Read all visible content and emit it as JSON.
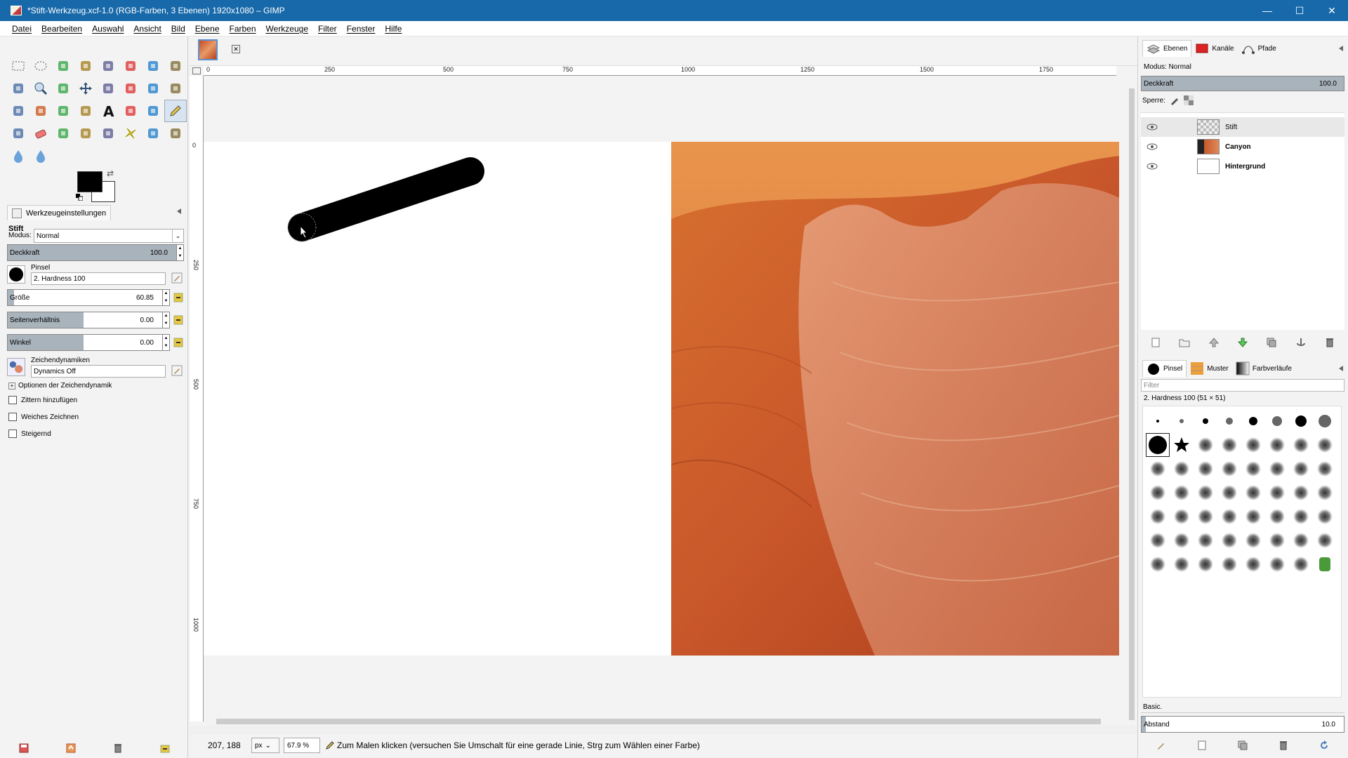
{
  "window": {
    "title": "*Stift-Werkzeug.xcf-1.0 (RGB-Farben, 3 Ebenen) 1920x1080 – GIMP",
    "minimize": "—",
    "maximize": "☐",
    "close": "✕"
  },
  "menu": [
    "Datei",
    "Bearbeiten",
    "Auswahl",
    "Ansicht",
    "Bild",
    "Ebene",
    "Farben",
    "Werkzeuge",
    "Filter",
    "Fenster",
    "Hilfe"
  ],
  "toolbox": {
    "tools": [
      "rect-select-icon",
      "ellipse-select-icon",
      "lasso-icon",
      "fuzzy-select-icon",
      "color-select-icon",
      "scissors-icon",
      "foreground-select-icon",
      "paths-icon",
      "color-picker-icon",
      "zoom-icon",
      "measure-icon",
      "move-icon",
      "align-icon",
      "crop-icon",
      "rotate-icon",
      "scale-icon",
      "shear-icon",
      "perspective-icon",
      "flip-icon",
      "cage-icon",
      "text-icon",
      "heal-icon",
      "blend-icon",
      "pencil-icon",
      "paintbrush-icon",
      "eraser-icon",
      "airbrush-icon",
      "ink-icon",
      "clone-icon",
      "heal2-icon",
      "smudge-icon",
      "dodge-icon",
      "blur-icon",
      "bucket-icon"
    ],
    "active_tool": "pencil-icon",
    "fg_color": "#000000",
    "bg_color": "#ffffff"
  },
  "tool_options": {
    "tab_label": "Werkzeugeinstellungen",
    "tool_name": "Stift",
    "mode_label": "Modus:",
    "mode_value": "Normal",
    "opacity_label": "Deckkraft",
    "opacity_value": "100.0",
    "opacity_level": 1.0,
    "brush_label": "Pinsel",
    "brush_value": "2. Hardness 100",
    "size_label": "Größe",
    "size_value": "60.85",
    "size_level": 0.04,
    "aspect_label": "Seitenverhältnis",
    "aspect_value": "0.00",
    "angle_label": "Winkel",
    "angle_value": "0.00",
    "dynamics_label": "Zeichendynamiken",
    "dynamics_value": "Dynamics Off",
    "dynamics_options": "Optionen der Zeichendynamik",
    "jitter": "Zittern hinzufügen",
    "smooth": "Weiches Zeichnen",
    "incremental": "Steigernd"
  },
  "ruler": {
    "top": [
      "0",
      "250",
      "500",
      "750",
      "1000",
      "1250",
      "1500",
      "1750"
    ],
    "left": [
      "0",
      "250",
      "500",
      "750",
      "1000"
    ]
  },
  "status": {
    "coords": "207, 188",
    "unit": "px",
    "zoom": "67.9 %",
    "message": "Zum Malen klicken (versuchen Sie Umschalt für eine gerade Linie, Strg zum Wählen einer Farbe)"
  },
  "layers_dock": {
    "tabs": [
      "Ebenen",
      "Kanäle",
      "Pfade"
    ],
    "mode_label": "Modus:",
    "mode_value": "Normal",
    "opacity_label": "Deckkraft",
    "opacity_value": "100.0",
    "lock_label": "Sperre:",
    "layers": [
      {
        "name": "Stift",
        "selected": true
      },
      {
        "name": "Canyon",
        "selected": false
      },
      {
        "name": "Hintergrund",
        "selected": false
      }
    ]
  },
  "brushes_dock": {
    "tabs": [
      "Pinsel",
      "Muster",
      "Farbverläufe"
    ],
    "filter_placeholder": "Filter",
    "current": "2. Hardness 100 (51 × 51)",
    "preset": "Basic.",
    "spacing_label": "Abstand",
    "spacing_value": "10.0"
  }
}
